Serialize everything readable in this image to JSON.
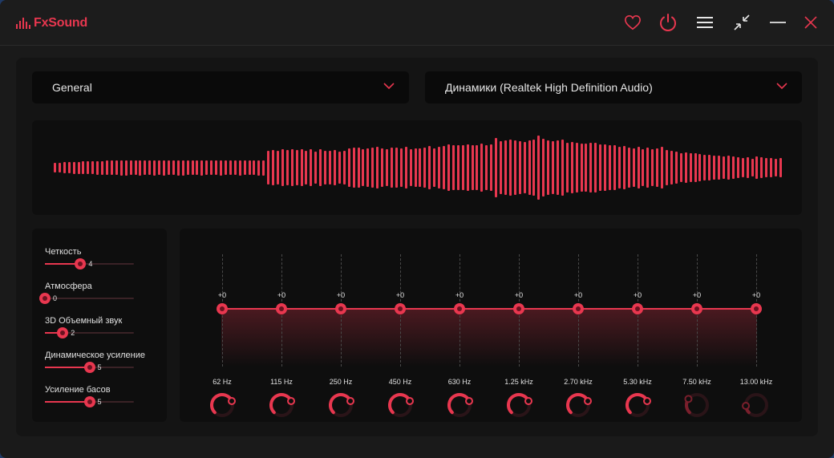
{
  "app": {
    "logo_text": "FxSound"
  },
  "titlebar": {
    "icons": [
      "heart-icon",
      "power-icon",
      "menu-icon",
      "minimize-view-icon",
      "minimize-icon",
      "close-icon"
    ]
  },
  "colors": {
    "accent": "#e8374f",
    "background": "#1a1a1a",
    "panel": "#141414",
    "inner": "#0e0e0e"
  },
  "preset": {
    "value": "General"
  },
  "output": {
    "value": "Динамики (Realtek High Definition Audio)"
  },
  "visualizer": {
    "levels": [
      0.12,
      0.12,
      0.14,
      0.14,
      0.15,
      0.15,
      0.16,
      0.16,
      0.16,
      0.17,
      0.17,
      0.18,
      0.18,
      0.18,
      0.19,
      0.19,
      0.18,
      0.18,
      0.19,
      0.18,
      0.18,
      0.19,
      0.18,
      0.19,
      0.18,
      0.18,
      0.19,
      0.19,
      0.18,
      0.18,
      0.18,
      0.19,
      0.18,
      0.18,
      0.18,
      0.19,
      0.18,
      0.18,
      0.18,
      0.19,
      0.18,
      0.18,
      0.18,
      0.19,
      0.19,
      0.42,
      0.44,
      0.42,
      0.46,
      0.44,
      0.46,
      0.44,
      0.46,
      0.42,
      0.46,
      0.4,
      0.46,
      0.42,
      0.42,
      0.44,
      0.4,
      0.42,
      0.48,
      0.5,
      0.5,
      0.46,
      0.48,
      0.5,
      0.52,
      0.48,
      0.46,
      0.5,
      0.5,
      0.48,
      0.52,
      0.46,
      0.48,
      0.48,
      0.5,
      0.54,
      0.48,
      0.52,
      0.54,
      0.58,
      0.56,
      0.56,
      0.56,
      0.58,
      0.56,
      0.56,
      0.6,
      0.56,
      0.58,
      0.74,
      0.66,
      0.68,
      0.7,
      0.68,
      0.66,
      0.64,
      0.68,
      0.7,
      0.8,
      0.72,
      0.68,
      0.66,
      0.68,
      0.7,
      0.62,
      0.64,
      0.62,
      0.6,
      0.6,
      0.62,
      0.62,
      0.58,
      0.58,
      0.56,
      0.56,
      0.52,
      0.54,
      0.5,
      0.48,
      0.52,
      0.46,
      0.5,
      0.46,
      0.48,
      0.52,
      0.44,
      0.42,
      0.4,
      0.36,
      0.38,
      0.36,
      0.36,
      0.34,
      0.32,
      0.32,
      0.3,
      0.3,
      0.28,
      0.3,
      0.28,
      0.26,
      0.24,
      0.26,
      0.22,
      0.28,
      0.26,
      0.24,
      0.24,
      0.22,
      0.24
    ]
  },
  "effects": [
    {
      "label": "Четкость",
      "value": "4",
      "level": 0.4
    },
    {
      "label": "Атмосфера",
      "value": "0",
      "level": 0.0
    },
    {
      "label": "3D Объемный звук",
      "value": "2",
      "level": 0.2
    },
    {
      "label": "Динамическое усиление",
      "value": "5",
      "level": 0.5
    },
    {
      "label": "Усиление басов",
      "value": "5",
      "level": 0.5
    }
  ],
  "eq": {
    "bands": [
      {
        "freq": "62 Hz",
        "gain": "+0",
        "knob_level": 0.75,
        "active": true
      },
      {
        "freq": "115 Hz",
        "gain": "+0",
        "knob_level": 0.75,
        "active": true
      },
      {
        "freq": "250 Hz",
        "gain": "+0",
        "knob_level": 0.75,
        "active": true
      },
      {
        "freq": "450 Hz",
        "gain": "+0",
        "knob_level": 0.75,
        "active": true
      },
      {
        "freq": "630 Hz",
        "gain": "+0",
        "knob_level": 0.75,
        "active": true
      },
      {
        "freq": "1.25 kHz",
        "gain": "+0",
        "knob_level": 0.75,
        "active": true
      },
      {
        "freq": "2.70 kHz",
        "gain": "+0",
        "knob_level": 0.75,
        "active": true
      },
      {
        "freq": "5.30 kHz",
        "gain": "+0",
        "knob_level": 0.75,
        "active": true
      },
      {
        "freq": "7.50 kHz",
        "gain": "+0",
        "knob_level": 0.3,
        "active": false
      },
      {
        "freq": "13.00 kHz",
        "gain": "+0",
        "knob_level": 0.15,
        "active": false
      }
    ]
  }
}
